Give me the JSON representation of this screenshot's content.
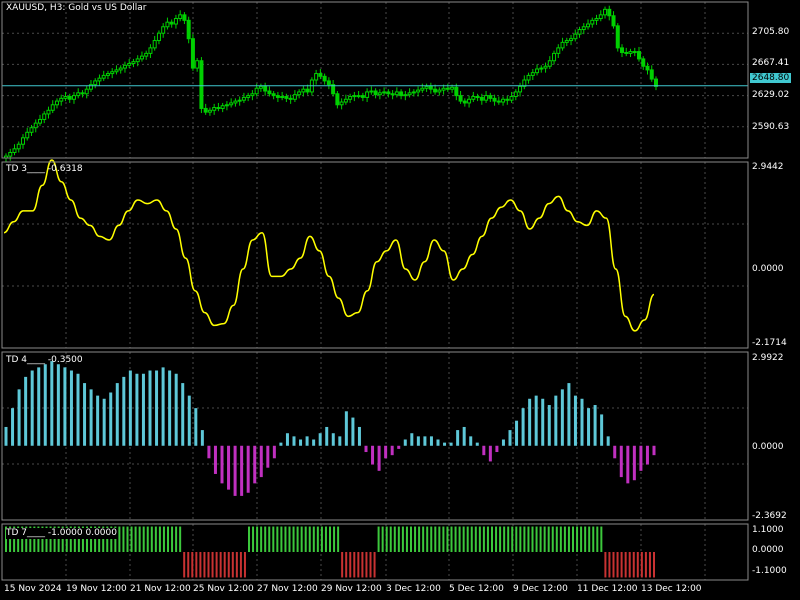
{
  "symbol_title": "XAUUSD, H3:  Gold vs US Dollar",
  "current_price": "2648.80",
  "colors": {
    "background": "#000000",
    "grid": "#4a4a4a",
    "bull_candle": "#00d000",
    "bear_candle": "#00d000",
    "price_line": "#40c8d0",
    "td3_line": "#ffff00",
    "td4_positive": "#5ec8d8",
    "td4_negative": "#c030c0",
    "td7_positive": "#3cc83c",
    "td7_negative": "#c83232"
  },
  "panels": {
    "price": {
      "y_labels": [
        "2705.80",
        "2667.41",
        "2629.02",
        "2590.63"
      ]
    },
    "td3": {
      "title": "TD 3",
      "value": "-0.6318",
      "y_labels": [
        "2.9442",
        "0.0000",
        "-2.1714"
      ]
    },
    "td4": {
      "title": "TD 4",
      "value": "-0.3500",
      "y_labels": [
        "2.9922",
        "0.0000",
        "-2.3692"
      ]
    },
    "td7": {
      "title": "TD 7",
      "value": "-1.0000 0.0000",
      "y_labels": [
        "1.1000",
        "0.0000",
        "-1.1000"
      ]
    }
  },
  "x_labels": [
    "15 Nov 2024",
    "19 Nov 12:00",
    "21 Nov 12:00",
    "25 Nov 12:00",
    "27 Nov 12:00",
    "29 Nov 12:00",
    "3 Dec 12:00",
    "5 Dec 12:00",
    "9 Dec 12:00",
    "11 Dec 12:00",
    "13 Dec 12:00"
  ],
  "chart_data": [
    {
      "type": "candlestick",
      "title": "XAUUSD, H3:  Gold vs US Dollar",
      "ylim": [
        2570,
        2740
      ],
      "close": [
        2572,
        2576,
        2580,
        2585,
        2592,
        2598,
        2603,
        2608,
        2612,
        2618,
        2622,
        2628,
        2632,
        2635,
        2637,
        2634,
        2638,
        2641,
        2640,
        2645,
        2650,
        2654,
        2657,
        2660,
        2662,
        2664,
        2666,
        2668,
        2671,
        2673,
        2675,
        2678,
        2681,
        2684,
        2690,
        2698,
        2706,
        2713,
        2718,
        2716,
        2722,
        2726,
        2720,
        2700,
        2668,
        2676,
        2624,
        2620,
        2622,
        2625,
        2624,
        2627,
        2628,
        2630,
        2632,
        2633,
        2636,
        2638,
        2640,
        2646,
        2648,
        2643,
        2640,
        2638,
        2636,
        2637,
        2635,
        2634,
        2639,
        2642,
        2645,
        2642,
        2655,
        2662,
        2659,
        2654,
        2650,
        2640,
        2628,
        2631,
        2634,
        2637,
        2638,
        2638,
        2636,
        2642,
        2643,
        2639,
        2641,
        2642,
        2640,
        2639,
        2642,
        2638,
        2639,
        2641,
        2642,
        2644,
        2646,
        2648,
        2645,
        2642,
        2644,
        2646,
        2645,
        2647,
        2638,
        2632,
        2630,
        2634,
        2637,
        2636,
        2633,
        2638,
        2635,
        2632,
        2631,
        2634,
        2633,
        2637,
        2642,
        2648,
        2655,
        2660,
        2663,
        2667,
        2668,
        2670,
        2676,
        2684,
        2690,
        2696,
        2698,
        2700,
        2705,
        2710,
        2713,
        2716,
        2720,
        2722,
        2726,
        2732,
        2725,
        2714,
        2690,
        2685,
        2684,
        2686,
        2686,
        2678,
        2670,
        2666,
        2656,
        2648
      ]
    },
    {
      "type": "line",
      "series": [
        {
          "name": "TD 3",
          "values": [
            1.0,
            1.3,
            1.6,
            1.6,
            2.3,
            3.0,
            2.4,
            1.9,
            1.4,
            1.2,
            0.9,
            0.8,
            1.2,
            1.6,
            1.9,
            1.8,
            1.9,
            1.6,
            1.1,
            0.3,
            -0.6,
            -1.2,
            -1.55,
            -1.5,
            -1.0,
            0.0,
            0.8,
            1.0,
            -0.2,
            -0.2,
            0.0,
            0.3,
            0.9,
            0.5,
            -0.2,
            -0.8,
            -1.3,
            -1.2,
            -0.6,
            0.2,
            0.5,
            0.8,
            0.0,
            -0.3,
            0.2,
            0.8,
            0.5,
            -0.3,
            0.0,
            0.4,
            0.9,
            1.4,
            1.7,
            1.9,
            1.6,
            1.1,
            1.4,
            1.8,
            2.0,
            1.6,
            1.3,
            1.2,
            1.6,
            1.4,
            0.0,
            -1.3,
            -1.7,
            -1.4,
            -0.7
          ]
        }
      ],
      "ylim": [
        -2.1714,
        2.9442
      ]
    },
    {
      "type": "bar",
      "series": [
        {
          "name": "TD 4",
          "values": [
            0.6,
            1.2,
            1.8,
            2.2,
            2.4,
            2.5,
            2.6,
            2.7,
            2.6,
            2.5,
            2.4,
            2.3,
            2.0,
            1.8,
            1.6,
            1.5,
            1.7,
            2.0,
            2.2,
            2.4,
            2.3,
            2.3,
            2.4,
            2.4,
            2.5,
            2.4,
            2.3,
            2.0,
            1.6,
            1.2,
            0.5,
            -0.4,
            -0.9,
            -1.2,
            -1.4,
            -1.6,
            -1.6,
            -1.5,
            -1.2,
            -1.0,
            -0.7,
            -0.4,
            0.1,
            0.4,
            0.3,
            0.2,
            0.3,
            0.2,
            0.4,
            0.6,
            0.4,
            0.3,
            1.1,
            0.9,
            0.6,
            -0.2,
            -0.6,
            -0.8,
            -0.4,
            -0.3,
            -0.1,
            0.2,
            0.4,
            0.3,
            0.3,
            0.3,
            0.2,
            0.1,
            0.1,
            0.5,
            0.6,
            0.3,
            0.1,
            -0.3,
            -0.5,
            -0.2,
            0.2,
            0.5,
            0.8,
            1.2,
            1.5,
            1.6,
            1.5,
            1.3,
            1.6,
            1.8,
            2.0,
            1.6,
            1.5,
            1.2,
            1.3,
            1.0,
            0.3,
            -0.4,
            -1.0,
            -1.2,
            -1.1,
            -0.8,
            -0.6,
            -0.3
          ]
        }
      ],
      "ylim": [
        -2.3692,
        2.9922
      ]
    },
    {
      "type": "bar",
      "series": [
        {
          "name": "TD 7",
          "values": [
            1,
            1,
            1,
            1,
            1,
            1,
            1,
            1,
            1,
            1,
            1,
            1,
            1,
            1,
            1,
            1,
            1,
            1,
            1,
            1,
            1,
            1,
            1,
            1,
            1,
            1,
            1,
            1,
            1,
            1,
            1,
            1,
            1,
            1,
            1,
            1,
            1,
            1,
            1,
            1,
            1,
            1,
            1,
            1,
            -1,
            -1,
            -1,
            -1,
            -1,
            -1,
            -1,
            -1,
            -1,
            -1,
            -1,
            -1,
            -1,
            -1,
            -1,
            -1,
            1,
            1,
            1,
            1,
            1,
            1,
            1,
            1,
            1,
            1,
            1,
            1,
            1,
            1,
            1,
            1,
            1,
            1,
            1,
            1,
            1,
            1,
            1,
            -1,
            -1,
            -1,
            -1,
            -1,
            -1,
            -1,
            -1,
            -1,
            1,
            1,
            1,
            1,
            1,
            1,
            1,
            1,
            1,
            1,
            1,
            1,
            1,
            1,
            1,
            1,
            1,
            1,
            1,
            1,
            1,
            1,
            1,
            1,
            1,
            1,
            1,
            1,
            1,
            1,
            1,
            1,
            1,
            1,
            1,
            1,
            1,
            1,
            1,
            1,
            1,
            1,
            1,
            1,
            1,
            1,
            1,
            1,
            1,
            1,
            1,
            1,
            1,
            1,
            1,
            1,
            -1,
            -1,
            -1,
            -1,
            -1,
            -1,
            -1,
            -1,
            -1,
            -1,
            -1,
            -1,
            -1
          ]
        }
      ],
      "ylim": [
        -1.1,
        1.1
      ]
    }
  ]
}
